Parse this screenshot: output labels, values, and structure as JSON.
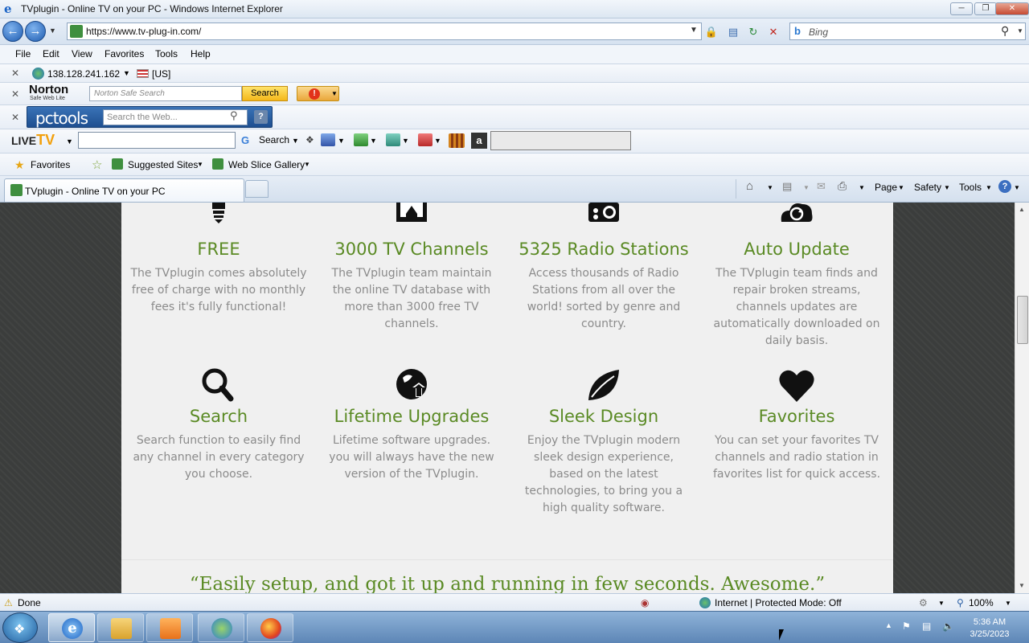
{
  "window": {
    "title": "TVplugin - Online TV on your PC - Windows Internet Explorer",
    "minimize": "─",
    "restore": "❐",
    "close": "✕"
  },
  "address": {
    "url": "https://www.tv-plug-in.com/",
    "search_placeholder": "Bing"
  },
  "menu": [
    "File",
    "Edit",
    "View",
    "Favorites",
    "Tools",
    "Help"
  ],
  "ip_bar": {
    "ip": "138.128.241.162",
    "country": "[US]"
  },
  "norton": {
    "logo": "Norton",
    "sub": "Safe Web Lite",
    "placeholder": "Norton Safe Search",
    "search": "Search"
  },
  "pctools": {
    "logo": "pctools",
    "placeholder": "Search the Web..."
  },
  "livetv": {
    "logo_live": "LIVE",
    "logo_tv": "TV",
    "search": "Search"
  },
  "favorites_bar": {
    "favorites": "Favorites",
    "suggested": "Suggested Sites",
    "gallery": "Web Slice Gallery"
  },
  "tab": {
    "title": "TVplugin - Online TV on your PC"
  },
  "commands": {
    "page": "Page",
    "safety": "Safety",
    "tools": "Tools"
  },
  "features": [
    {
      "title": "FREE",
      "desc": "The TVplugin comes absolutely free of charge with no monthly fees it's fully functional!",
      "icon": "lightbulb-icon"
    },
    {
      "title": "3000 TV Channels",
      "desc": "The TVplugin team maintain the online TV database with more than 3000 free TV channels.",
      "icon": "tv-icon"
    },
    {
      "title": "5325 Radio Stations",
      "desc": "Access thousands of Radio Stations from all over the world! sorted by genre and country.",
      "icon": "radio-icon"
    },
    {
      "title": "Auto Update",
      "desc": "The TVplugin team finds and repair broken streams, channels updates are automatically downloaded on daily basis.",
      "icon": "refresh-cloud-icon"
    },
    {
      "title": "Search",
      "desc": "Search function to easily find any channel in every category you choose.",
      "icon": "magnifier-icon"
    },
    {
      "title": "Lifetime Upgrades",
      "desc": "Lifetime software upgrades. you will always have the new version of the TVplugin.",
      "icon": "globe-upgrade-icon"
    },
    {
      "title": "Sleek Design",
      "desc": "Enjoy the TVplugin modern sleek design experience, based on the latest technologies, to bring you a high quality software.",
      "icon": "leaf-icon"
    },
    {
      "title": "Favorites",
      "desc": "You can set your favorites TV channels and radio station in favorites list for quick access.",
      "icon": "heart-icon"
    }
  ],
  "quote": "“Easily setup, and got it up and running in few seconds. Awesome.”",
  "status": {
    "text": "Done",
    "zone": "Internet | Protected Mode: Off",
    "zoom": "100%"
  },
  "clock": {
    "time": "5:36 AM",
    "date": "3/25/2023"
  },
  "colors": {
    "accent_green": "#5a8a24",
    "desc_gray": "#8b8b8b",
    "page_bg": "#f0f0f0"
  }
}
